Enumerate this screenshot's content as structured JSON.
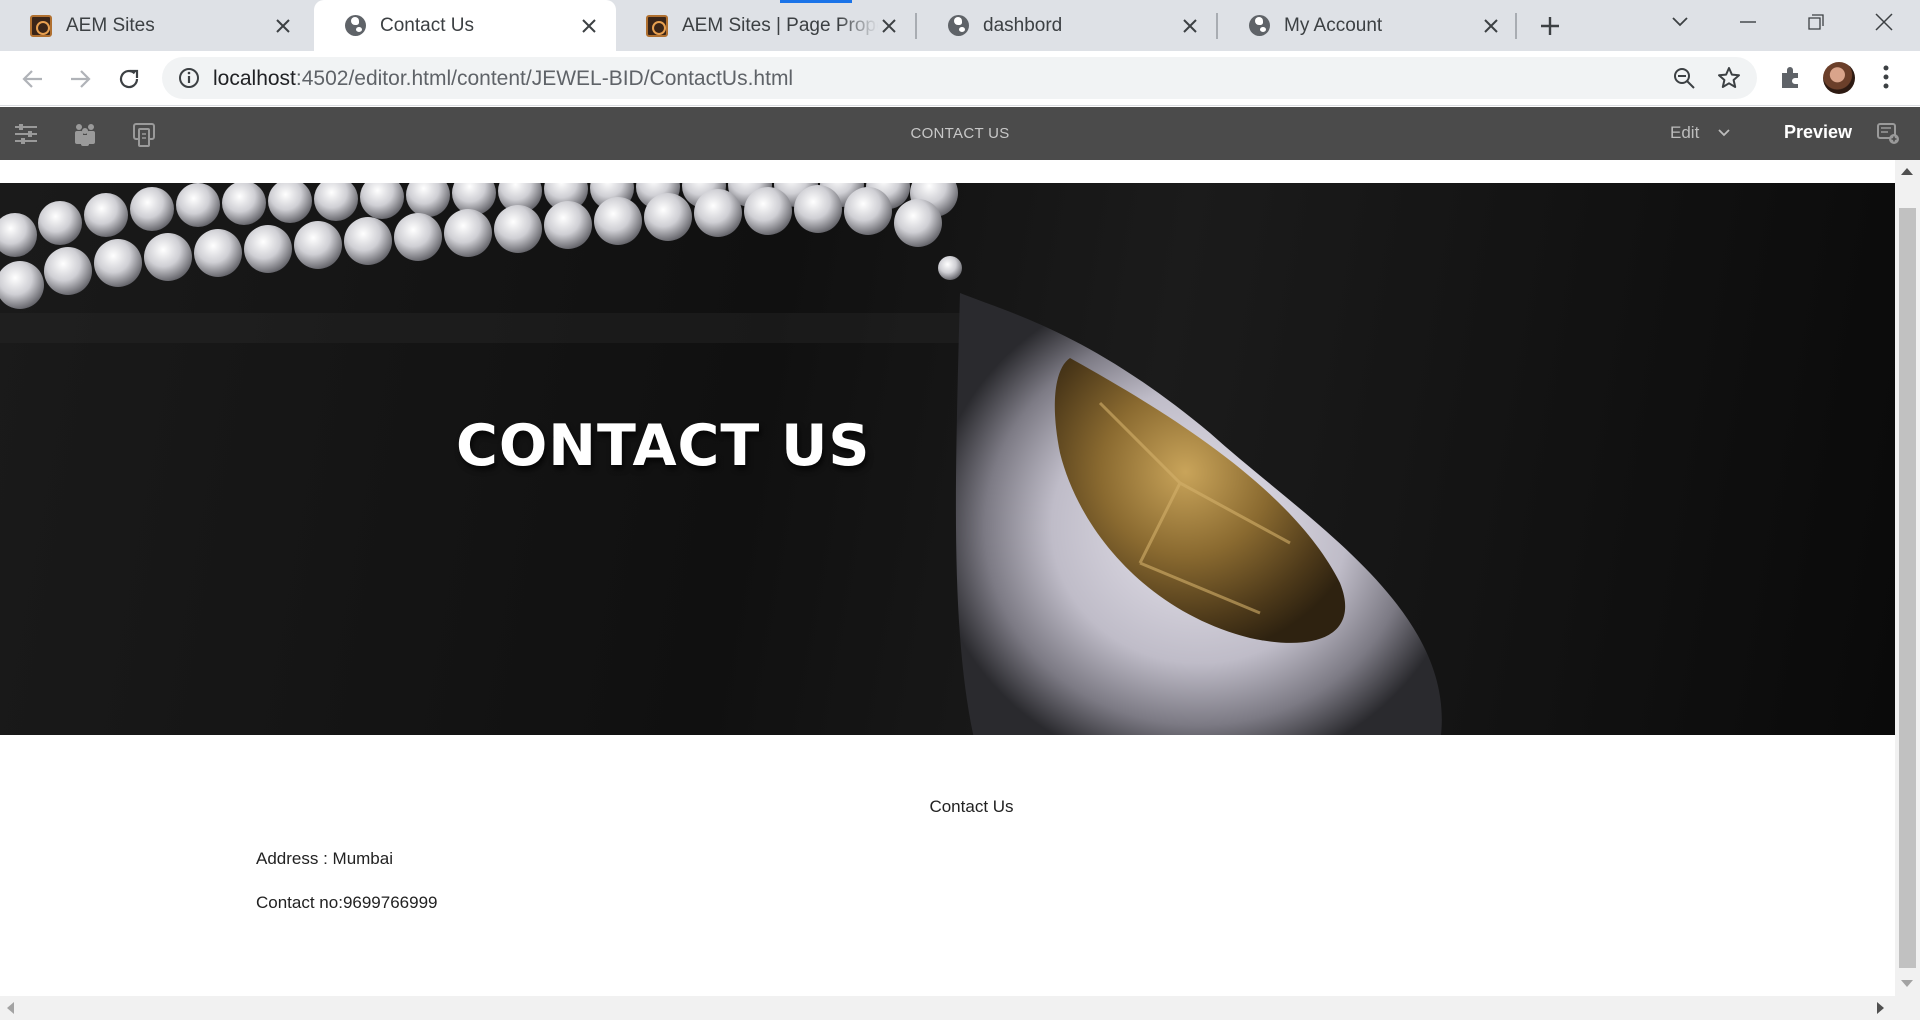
{
  "browser": {
    "tabs": [
      {
        "title": "AEM Sites",
        "favicon": "aem-sites-icon",
        "active": false
      },
      {
        "title": "Contact Us",
        "favicon": "globe-icon",
        "active": true
      },
      {
        "title": "AEM Sites | Page Properties",
        "favicon": "aem-sites-icon",
        "active": false
      },
      {
        "title": "dashbord",
        "favicon": "globe-icon",
        "active": false
      },
      {
        "title": "My Account",
        "favicon": "globe-icon",
        "active": false
      }
    ],
    "address": {
      "host": "localhost",
      "path": ":4502/editor.html/content/JEWEL-BID/ContactUs.html"
    },
    "accent_color": "#1a73e8"
  },
  "editor": {
    "page_title": "CONTACT US",
    "mode_label": "Edit",
    "preview_label": "Preview",
    "left_icons": [
      "side-panel-icon",
      "emulator-icon",
      "page-info-icon"
    ]
  },
  "page": {
    "hero_title": "CONTACT US",
    "section_title": "Contact Us",
    "address_line": "Address : Mumbai",
    "contact_line": "Contact no:9699766999"
  }
}
